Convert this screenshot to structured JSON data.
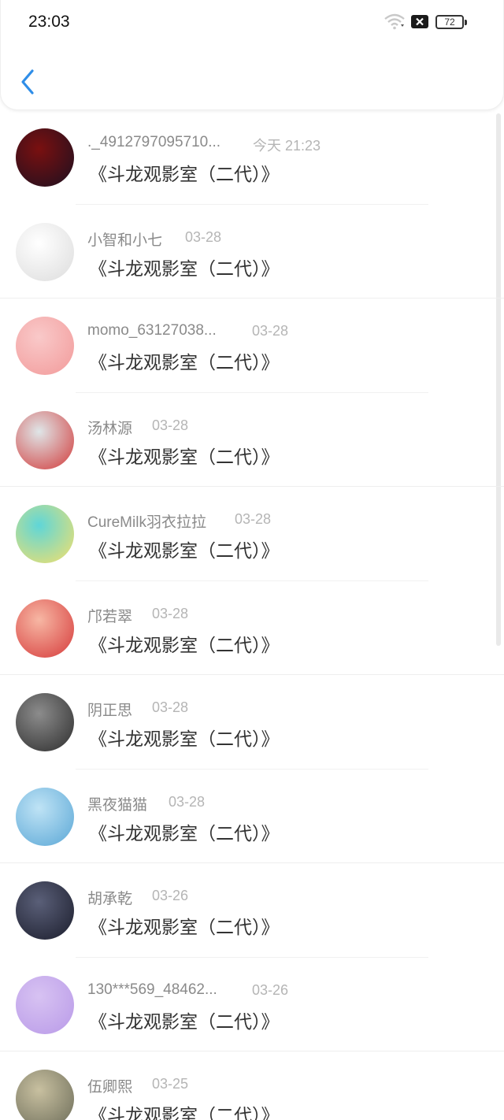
{
  "status": {
    "time": "23:03",
    "battery": "72"
  },
  "header": {
    "back_icon": "chevron-left-icon",
    "accent": "#2f8ee8"
  },
  "messages": [
    {
      "name": "._4912797095710...",
      "date": "今天 21:23",
      "text": "《斗龙观影室（二代）》",
      "avatar_colors": [
        "#7a1010",
        "#1c1020"
      ]
    },
    {
      "name": "小智和小七",
      "date": "03-28",
      "text": "《斗龙观影室（二代）》",
      "avatar_colors": [
        "#ffffff",
        "#dcdcdc"
      ]
    },
    {
      "name": "momo_63127038...",
      "date": "03-28",
      "text": "《斗龙观影室（二代）》",
      "avatar_colors": [
        "#f9c9c9",
        "#f29a9a"
      ]
    },
    {
      "name": "汤林源",
      "date": "03-28",
      "text": "《斗龙观影室（二代）》",
      "avatar_colors": [
        "#dfe6e8",
        "#d23a3a"
      ]
    },
    {
      "name": "CureMilk羽衣拉拉",
      "date": "03-28",
      "text": "《斗龙观影室（二代）》",
      "avatar_colors": [
        "#5fd6d8",
        "#f6e06a"
      ]
    },
    {
      "name": "邝若翠",
      "date": "03-28",
      "text": "《斗龙观影室（二代）》",
      "avatar_colors": [
        "#f7b7a4",
        "#d63a3a"
      ]
    },
    {
      "name": "阴正思",
      "date": "03-28",
      "text": "《斗龙观影室（二代）》",
      "avatar_colors": [
        "#8c8c8c",
        "#2d2d2d"
      ]
    },
    {
      "name": "黑夜猫猫",
      "date": "03-28",
      "text": "《斗龙观影室（二代）》",
      "avatar_colors": [
        "#bfe3f5",
        "#5aa7d6"
      ]
    },
    {
      "name": "胡承乾",
      "date": "03-26",
      "text": "《斗龙观影室（二代）》",
      "avatar_colors": [
        "#5a5f78",
        "#1b1d2c"
      ]
    },
    {
      "name": "130***569_48462...",
      "date": "03-26",
      "text": "《斗龙观影室（二代）》",
      "avatar_colors": [
        "#d7c2f2",
        "#b99ae8"
      ]
    },
    {
      "name": "伍卿熙",
      "date": "03-25",
      "text": "《斗龙观影室（二代）》",
      "avatar_colors": [
        "#c8c0a0",
        "#6b6b58"
      ]
    }
  ]
}
